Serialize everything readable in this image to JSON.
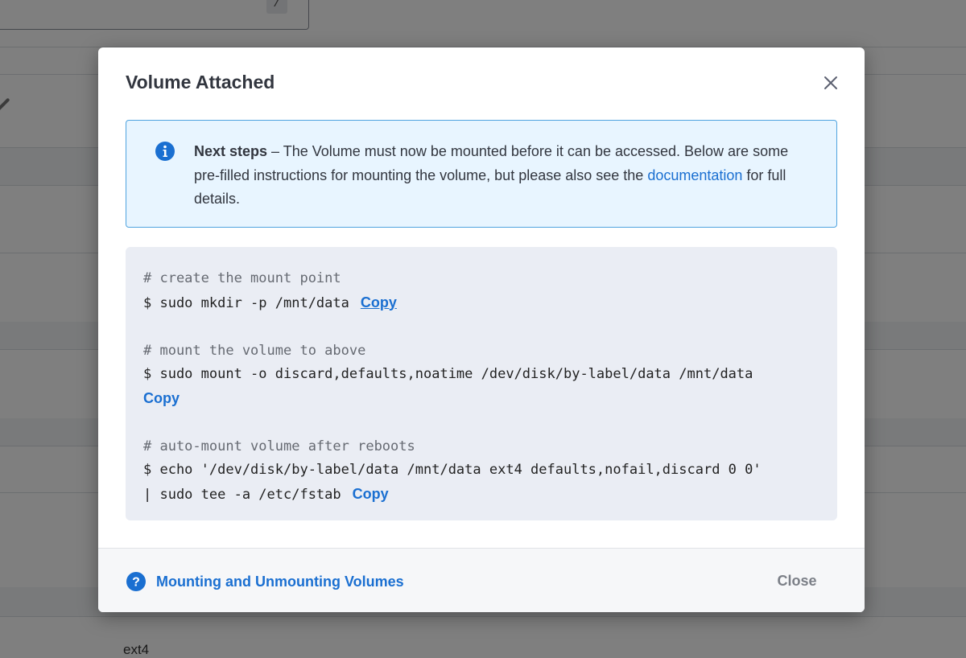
{
  "background": {
    "mount_point_value": "/",
    "filesystem_text": "ext4"
  },
  "modal": {
    "title": "Volume Attached",
    "info": {
      "heading": "Next steps",
      "body_before_link": " – The Volume must now be mounted before it can be accessed. Below are some pre-filled instructions for mounting the volume, but please also see the ",
      "link_text": "documentation",
      "body_after_link": " for full details."
    },
    "code": {
      "copy_label": "Copy",
      "blocks": [
        {
          "comment": "# create the mount point",
          "command": "$ sudo mkdir -p /mnt/data"
        },
        {
          "comment": "# mount the volume to above",
          "command": "$ sudo mount -o discard,defaults,noatime /dev/disk/by-label/data /mnt/data"
        },
        {
          "comment": "# auto-mount volume after reboots",
          "command_line1": "$ echo '/dev/disk/by-label/data /mnt/data ext4 defaults,nofail,discard 0 0'",
          "command_line2": "| sudo tee -a /etc/fstab"
        }
      ]
    },
    "footer": {
      "help_link": "Mounting and Unmounting Volumes",
      "close_label": "Close"
    }
  },
  "colors": {
    "accent": "#1a6fd1",
    "info_bg": "#e8f5ff",
    "info_border": "#4fa3df",
    "code_bg": "#eaedf4",
    "overlay": "rgba(0,0,0,0.5)"
  },
  "icons": {
    "close": "close-icon",
    "info": "info-icon",
    "help": "help-icon"
  }
}
